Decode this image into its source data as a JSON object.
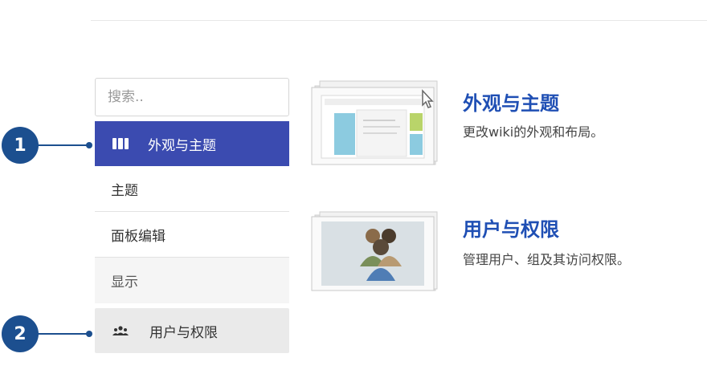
{
  "callouts": [
    "1",
    "2"
  ],
  "sidebar": {
    "search_placeholder": "搜索..",
    "active_section": {
      "label": "外观与主题",
      "icon": "layout-icon"
    },
    "sub_items": [
      "主题",
      "面板编辑",
      "显示"
    ],
    "section_users": {
      "label": "用户与权限",
      "icon": "users-icon"
    }
  },
  "content": {
    "appearance": {
      "title": "外观与主题",
      "description": "更改wiki的外观和布局。",
      "thumbnail": "layout-thumbnail"
    },
    "users": {
      "title": "用户与权限",
      "description": "管理用户、组及其访问权限。",
      "thumbnail": "users-thumbnail"
    }
  },
  "colors": {
    "accent": "#3b4bb0",
    "callout": "#1c4f8f",
    "link": "#1f4fb4"
  }
}
